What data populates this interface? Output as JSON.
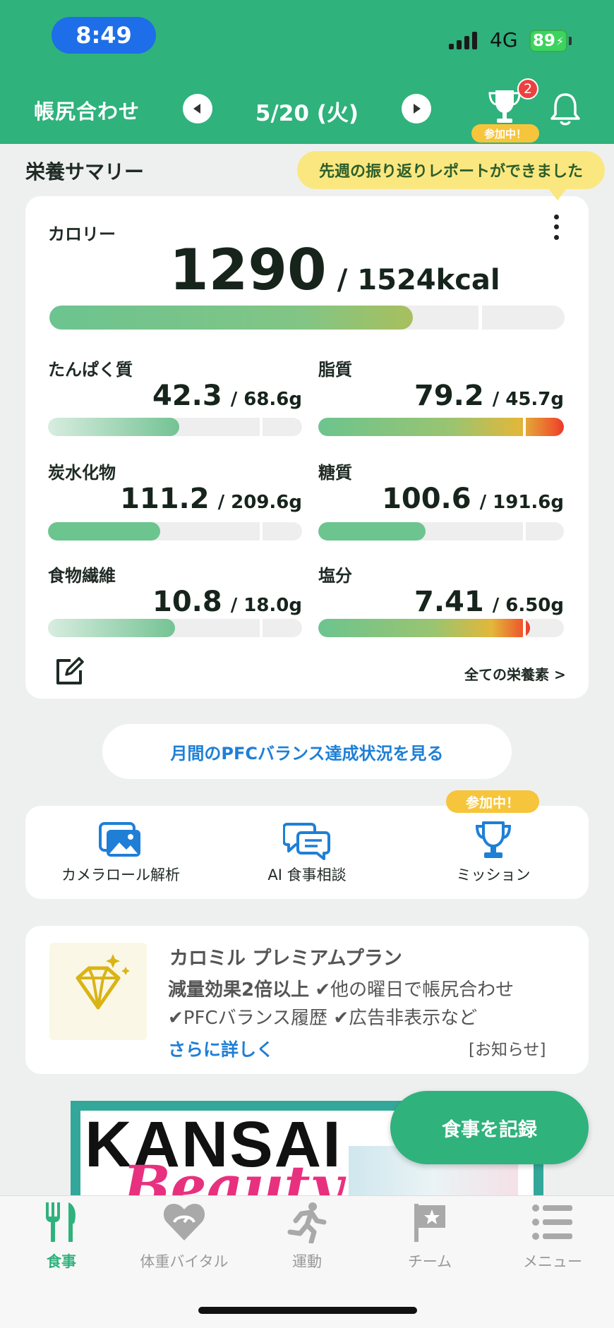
{
  "status_bar": {
    "time": "8:49",
    "network": "4G",
    "battery": "89"
  },
  "header": {
    "title": "帳尻合わせ",
    "date": "5/20 (火)",
    "trophy_badge_count": "2",
    "trophy_status": "参加中！"
  },
  "summary": {
    "section_title": "栄養サマリー",
    "tooltip": "先週の振り返りレポートができました",
    "calorie": {
      "label": "カロリー",
      "value": "1290",
      "target": "/ 1524kcal",
      "progress": 0.847
    },
    "nutrients": [
      {
        "label": "たんぱく質",
        "value": "42.3",
        "target": "/ 68.6g",
        "progress": 0.62
      },
      {
        "label": "脂質",
        "value": "79.2",
        "target": "/ 45.7g",
        "progress": 1.73
      },
      {
        "label": "炭水化物",
        "value": "111.2",
        "target": "/ 209.6g",
        "progress": 0.53
      },
      {
        "label": "糖質",
        "value": "100.6",
        "target": "/ 191.6g",
        "progress": 0.525
      },
      {
        "label": "食物繊維",
        "value": "10.8",
        "target": "/ 18.0g",
        "progress": 0.6
      },
      {
        "label": "塩分",
        "value": "7.41",
        "target": "/ 6.50g",
        "progress": 1.14
      }
    ],
    "all_nutrients_link": "全ての栄養素 >"
  },
  "pfc_button": "月間のPFCバランス達成状況を見る",
  "quick_actions": {
    "camera_roll": "カメラロール解析",
    "ai_consult": "AI 食事相談",
    "mission": "ミッション",
    "mission_status": "参加中！"
  },
  "premium": {
    "title": "カロミル プレミアムプラン",
    "line1_bold": "減量効果2倍以上",
    "line1_rest": " ✔他の曜日で帳尻合わせ",
    "line2": "✔PFCバランス履歴 ✔広告非表示など",
    "more": "さらに詳しく",
    "notice": "[お知らせ]"
  },
  "ad": {
    "title": "KANSAI",
    "script": "Beauty"
  },
  "record_button": "食事を記録",
  "tabs": [
    "食事",
    "体重バイタル",
    "運動",
    "チーム",
    "メニュー"
  ],
  "colors": {
    "brand_green": "#2fb27c",
    "link_blue": "#1f7fd6",
    "badge_red": "#ef4040",
    "pill_yellow": "#f6c53b"
  }
}
